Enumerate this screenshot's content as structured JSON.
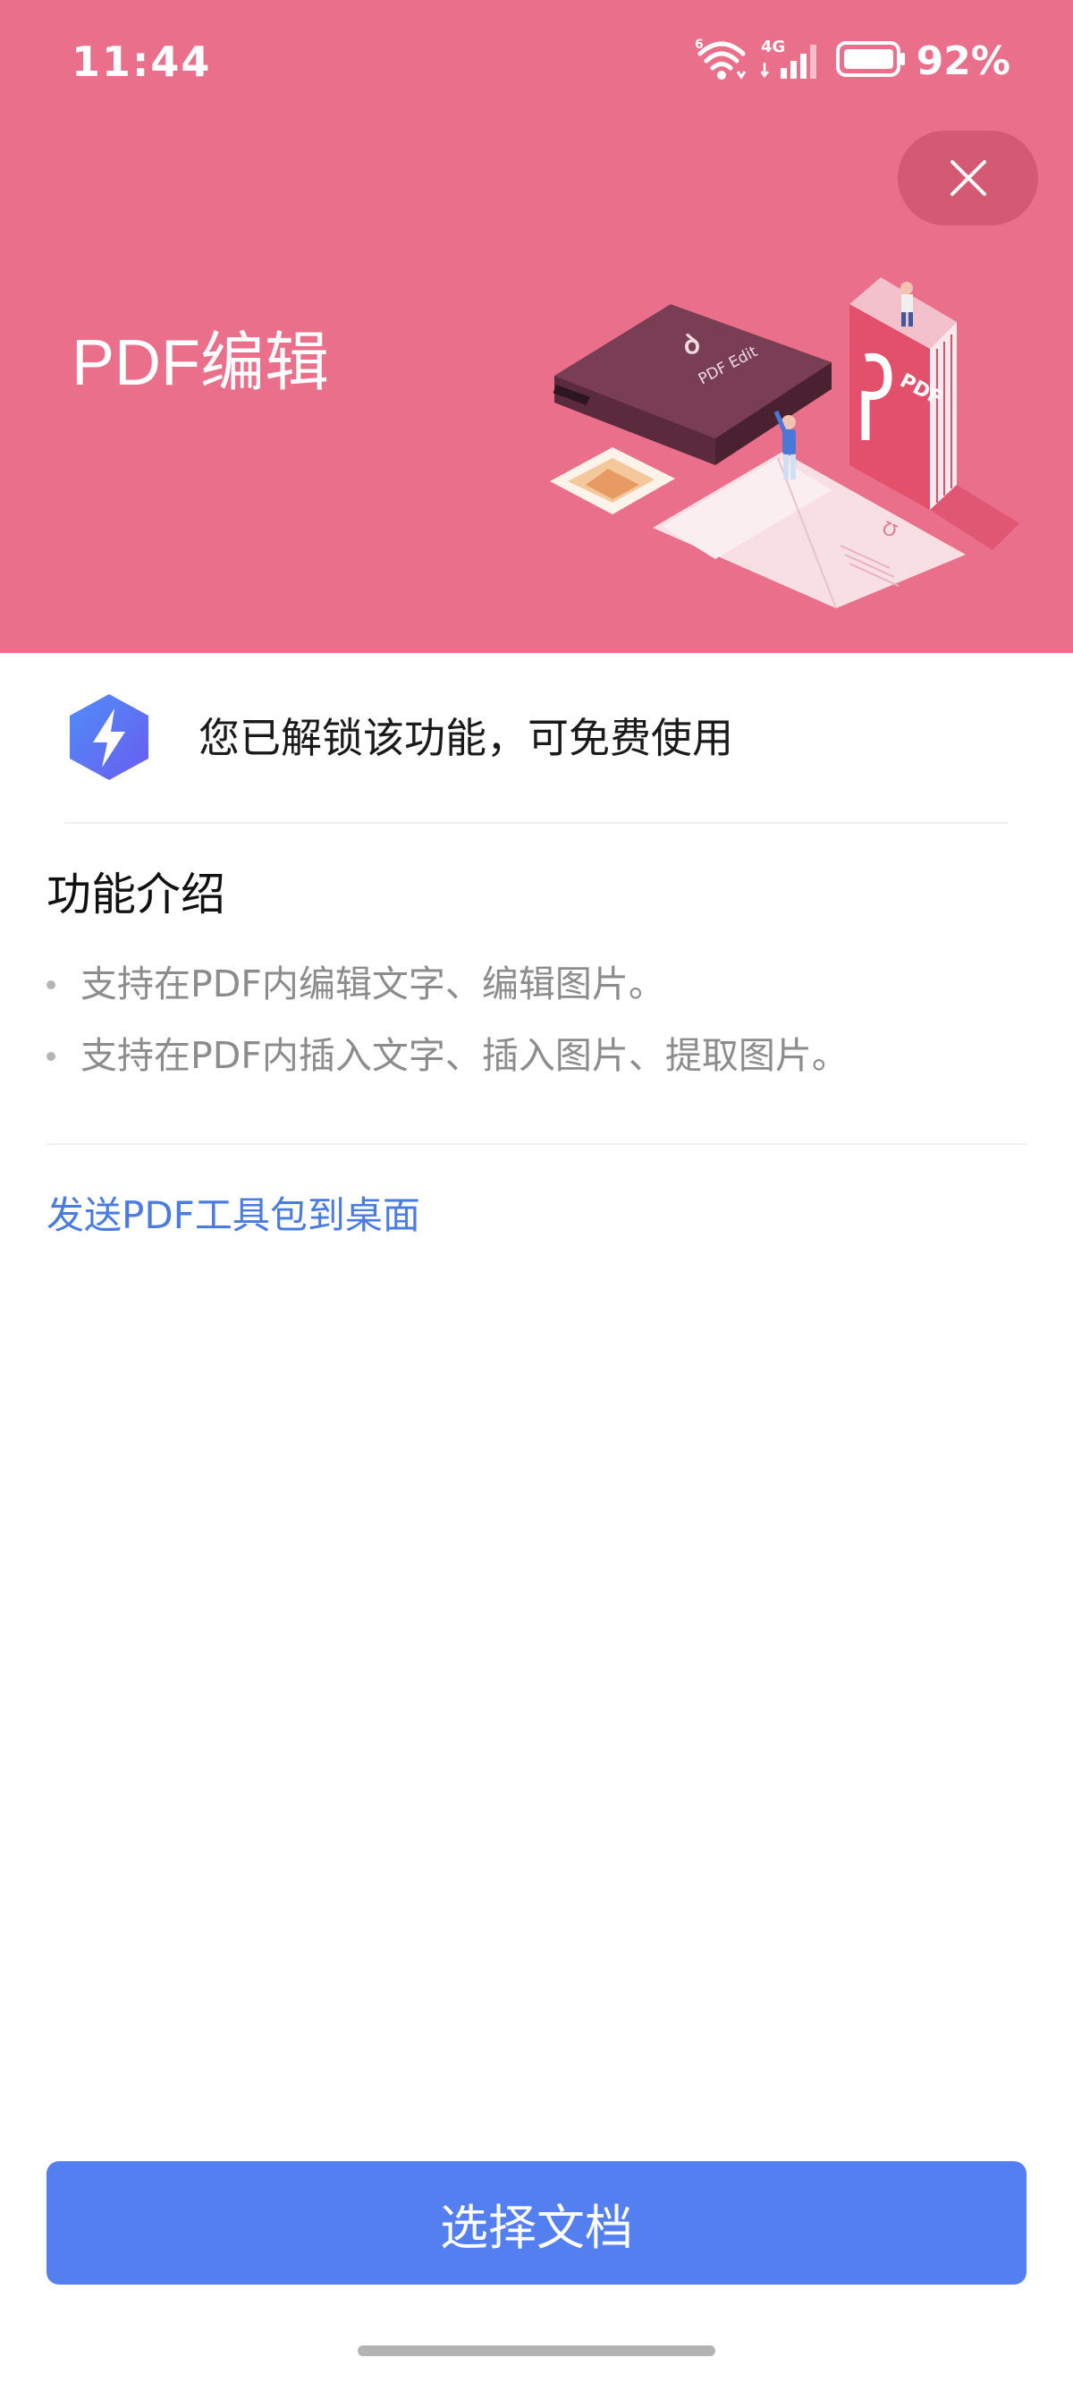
{
  "status_bar": {
    "time": "11:44",
    "wifi_icon": "wifi-6-icon",
    "network_label": "4G",
    "signal_icon": "cellular-signal-icon",
    "battery_icon": "battery-icon",
    "battery_percent": "92%"
  },
  "header": {
    "title": "PDF编辑",
    "close_icon": "close-icon",
    "illustration": {
      "device_label": "PDF Edit",
      "book_label": "PDF"
    },
    "background_color": "#ea6f8a"
  },
  "unlock_notice": {
    "icon": "lightning-bolt-icon",
    "text": "您已解锁该功能，可免费使用"
  },
  "intro": {
    "title": "功能介绍",
    "items": [
      "支持在PDF内编辑文字、编辑图片。",
      "支持在PDF内插入文字、插入图片、提取图片。"
    ]
  },
  "send_link": "发送PDF工具包到桌面",
  "actions": {
    "primary_label": "选择文档",
    "primary_color": "#547ff0"
  }
}
